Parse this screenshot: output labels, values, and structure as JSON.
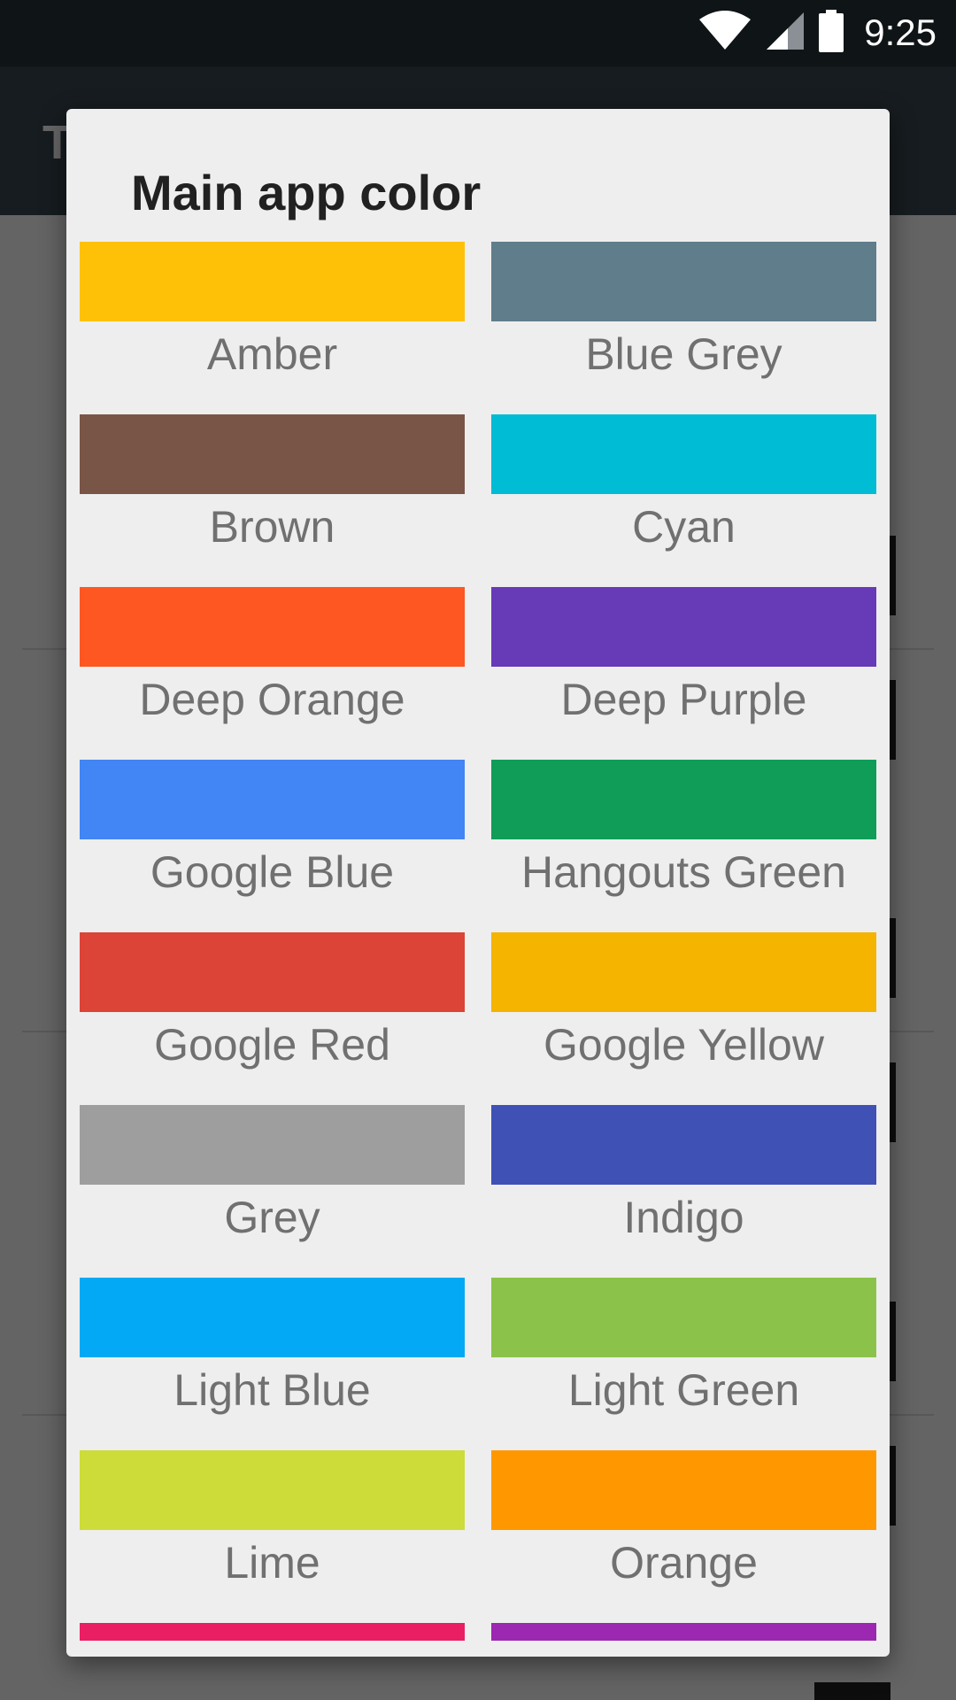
{
  "status_bar": {
    "time": "9:25",
    "icons": [
      "wifi-icon",
      "cell-signal-icon",
      "battery-icon"
    ]
  },
  "app_bar": {
    "title": "T"
  },
  "dialog": {
    "title": "Main app color",
    "colors": [
      {
        "label": "Amber",
        "hex": "#FFC107"
      },
      {
        "label": "Blue Grey",
        "hex": "#607D8B"
      },
      {
        "label": "Brown",
        "hex": "#795548"
      },
      {
        "label": "Cyan",
        "hex": "#00BCD4"
      },
      {
        "label": "Deep Orange",
        "hex": "#FF5722"
      },
      {
        "label": "Deep Purple",
        "hex": "#673AB7"
      },
      {
        "label": "Google Blue",
        "hex": "#4285F4"
      },
      {
        "label": "Hangouts Green",
        "hex": "#0F9D58"
      },
      {
        "label": "Google Red",
        "hex": "#DB4437"
      },
      {
        "label": "Google Yellow",
        "hex": "#F4B400"
      },
      {
        "label": "Grey",
        "hex": "#9E9E9E"
      },
      {
        "label": "Indigo",
        "hex": "#3F51B5"
      },
      {
        "label": "Light Blue",
        "hex": "#03A9F4"
      },
      {
        "label": "Light Green",
        "hex": "#8BC34A"
      },
      {
        "label": "Lime",
        "hex": "#CDDC39"
      },
      {
        "label": "Orange",
        "hex": "#FF9800"
      },
      {
        "label": "",
        "hex": "#E91E63"
      },
      {
        "label": "",
        "hex": "#9C27B0"
      }
    ]
  }
}
